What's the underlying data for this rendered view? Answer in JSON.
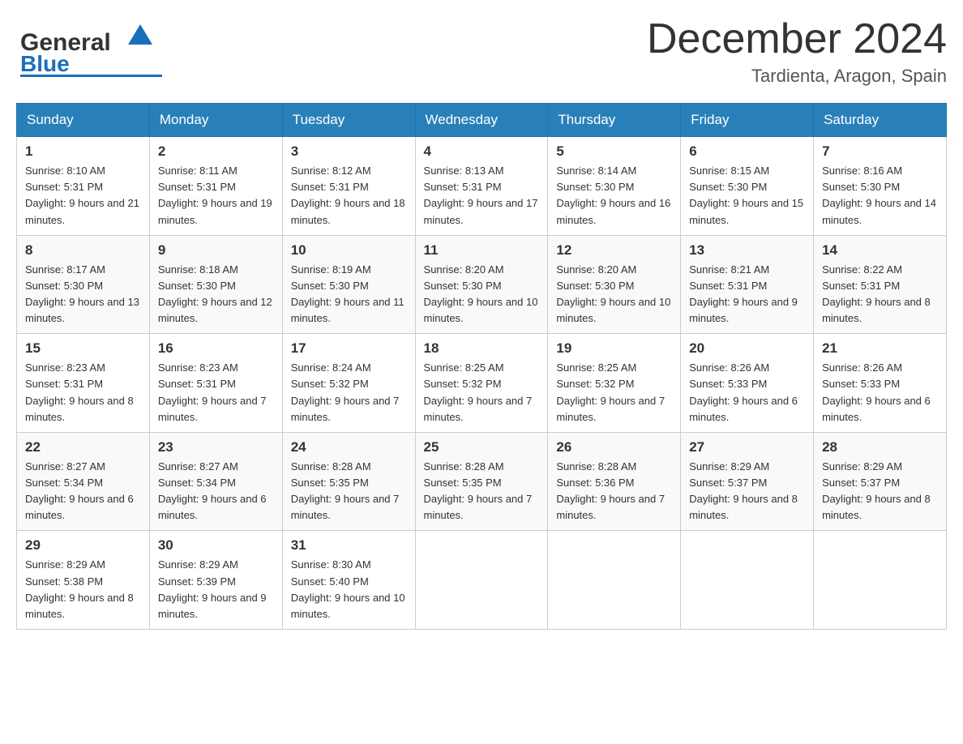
{
  "header": {
    "logo_general": "General",
    "logo_blue": "Blue",
    "month_title": "December 2024",
    "location": "Tardienta, Aragon, Spain"
  },
  "days_of_week": [
    "Sunday",
    "Monday",
    "Tuesday",
    "Wednesday",
    "Thursday",
    "Friday",
    "Saturday"
  ],
  "weeks": [
    [
      {
        "day": "1",
        "sunrise": "8:10 AM",
        "sunset": "5:31 PM",
        "daylight": "9 hours and 21 minutes."
      },
      {
        "day": "2",
        "sunrise": "8:11 AM",
        "sunset": "5:31 PM",
        "daylight": "9 hours and 19 minutes."
      },
      {
        "day": "3",
        "sunrise": "8:12 AM",
        "sunset": "5:31 PM",
        "daylight": "9 hours and 18 minutes."
      },
      {
        "day": "4",
        "sunrise": "8:13 AM",
        "sunset": "5:31 PM",
        "daylight": "9 hours and 17 minutes."
      },
      {
        "day": "5",
        "sunrise": "8:14 AM",
        "sunset": "5:30 PM",
        "daylight": "9 hours and 16 minutes."
      },
      {
        "day": "6",
        "sunrise": "8:15 AM",
        "sunset": "5:30 PM",
        "daylight": "9 hours and 15 minutes."
      },
      {
        "day": "7",
        "sunrise": "8:16 AM",
        "sunset": "5:30 PM",
        "daylight": "9 hours and 14 minutes."
      }
    ],
    [
      {
        "day": "8",
        "sunrise": "8:17 AM",
        "sunset": "5:30 PM",
        "daylight": "9 hours and 13 minutes."
      },
      {
        "day": "9",
        "sunrise": "8:18 AM",
        "sunset": "5:30 PM",
        "daylight": "9 hours and 12 minutes."
      },
      {
        "day": "10",
        "sunrise": "8:19 AM",
        "sunset": "5:30 PM",
        "daylight": "9 hours and 11 minutes."
      },
      {
        "day": "11",
        "sunrise": "8:20 AM",
        "sunset": "5:30 PM",
        "daylight": "9 hours and 10 minutes."
      },
      {
        "day": "12",
        "sunrise": "8:20 AM",
        "sunset": "5:30 PM",
        "daylight": "9 hours and 10 minutes."
      },
      {
        "day": "13",
        "sunrise": "8:21 AM",
        "sunset": "5:31 PM",
        "daylight": "9 hours and 9 minutes."
      },
      {
        "day": "14",
        "sunrise": "8:22 AM",
        "sunset": "5:31 PM",
        "daylight": "9 hours and 8 minutes."
      }
    ],
    [
      {
        "day": "15",
        "sunrise": "8:23 AM",
        "sunset": "5:31 PM",
        "daylight": "9 hours and 8 minutes."
      },
      {
        "day": "16",
        "sunrise": "8:23 AM",
        "sunset": "5:31 PM",
        "daylight": "9 hours and 7 minutes."
      },
      {
        "day": "17",
        "sunrise": "8:24 AM",
        "sunset": "5:32 PM",
        "daylight": "9 hours and 7 minutes."
      },
      {
        "day": "18",
        "sunrise": "8:25 AM",
        "sunset": "5:32 PM",
        "daylight": "9 hours and 7 minutes."
      },
      {
        "day": "19",
        "sunrise": "8:25 AM",
        "sunset": "5:32 PM",
        "daylight": "9 hours and 7 minutes."
      },
      {
        "day": "20",
        "sunrise": "8:26 AM",
        "sunset": "5:33 PM",
        "daylight": "9 hours and 6 minutes."
      },
      {
        "day": "21",
        "sunrise": "8:26 AM",
        "sunset": "5:33 PM",
        "daylight": "9 hours and 6 minutes."
      }
    ],
    [
      {
        "day": "22",
        "sunrise": "8:27 AM",
        "sunset": "5:34 PM",
        "daylight": "9 hours and 6 minutes."
      },
      {
        "day": "23",
        "sunrise": "8:27 AM",
        "sunset": "5:34 PM",
        "daylight": "9 hours and 6 minutes."
      },
      {
        "day": "24",
        "sunrise": "8:28 AM",
        "sunset": "5:35 PM",
        "daylight": "9 hours and 7 minutes."
      },
      {
        "day": "25",
        "sunrise": "8:28 AM",
        "sunset": "5:35 PM",
        "daylight": "9 hours and 7 minutes."
      },
      {
        "day": "26",
        "sunrise": "8:28 AM",
        "sunset": "5:36 PM",
        "daylight": "9 hours and 7 minutes."
      },
      {
        "day": "27",
        "sunrise": "8:29 AM",
        "sunset": "5:37 PM",
        "daylight": "9 hours and 8 minutes."
      },
      {
        "day": "28",
        "sunrise": "8:29 AM",
        "sunset": "5:37 PM",
        "daylight": "9 hours and 8 minutes."
      }
    ],
    [
      {
        "day": "29",
        "sunrise": "8:29 AM",
        "sunset": "5:38 PM",
        "daylight": "9 hours and 8 minutes."
      },
      {
        "day": "30",
        "sunrise": "8:29 AM",
        "sunset": "5:39 PM",
        "daylight": "9 hours and 9 minutes."
      },
      {
        "day": "31",
        "sunrise": "8:30 AM",
        "sunset": "5:40 PM",
        "daylight": "9 hours and 10 minutes."
      },
      null,
      null,
      null,
      null
    ]
  ],
  "sunrise_label": "Sunrise:",
  "sunset_label": "Sunset:",
  "daylight_label": "Daylight:"
}
